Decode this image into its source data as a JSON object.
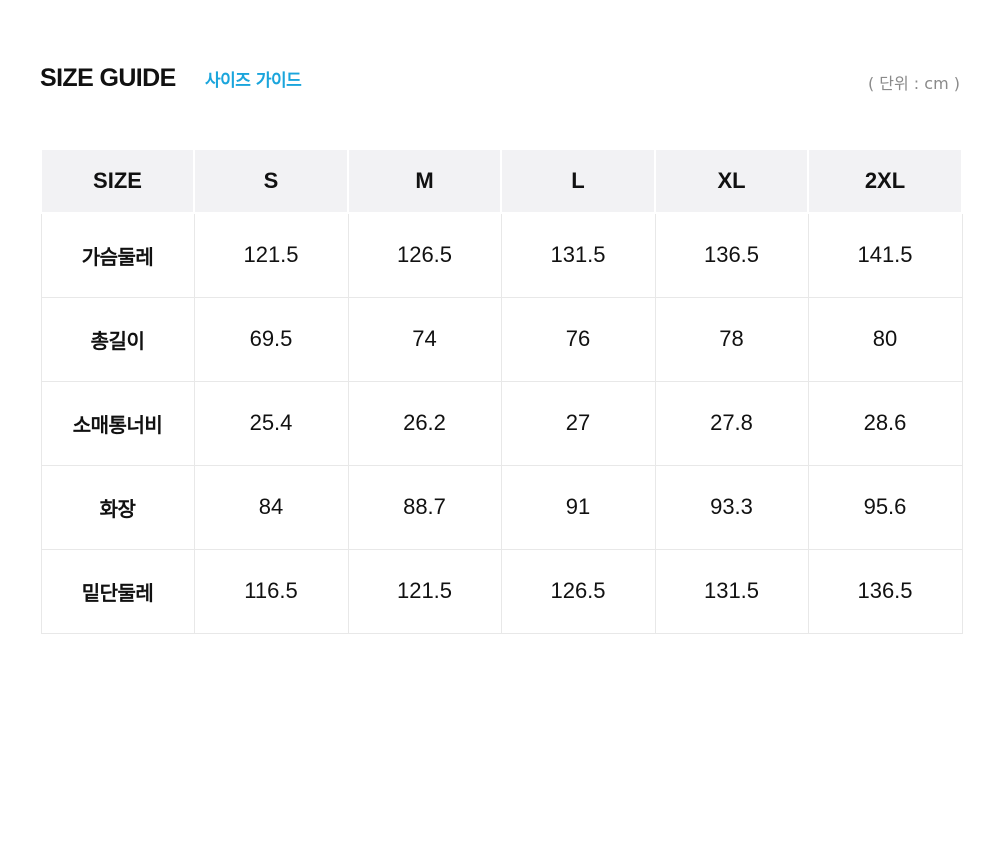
{
  "header": {
    "title": "SIZE GUIDE",
    "subtitle": "사이즈 가이드",
    "unit": "( 단위 : cm )"
  },
  "colors": {
    "accent": "#1aa5dc",
    "header_bg": "#f2f2f4",
    "border": "#e8e8e8",
    "unit_text": "#8a8a8a"
  },
  "table": {
    "columns": [
      "SIZE",
      "S",
      "M",
      "L",
      "XL",
      "2XL"
    ],
    "rows": [
      {
        "label": "가슴둘레",
        "values": [
          "121.5",
          "126.5",
          "131.5",
          "136.5",
          "141.5"
        ]
      },
      {
        "label": "총길이",
        "values": [
          "69.5",
          "74",
          "76",
          "78",
          "80"
        ]
      },
      {
        "label": "소매통너비",
        "values": [
          "25.4",
          "26.2",
          "27",
          "27.8",
          "28.6"
        ]
      },
      {
        "label": "화장",
        "values": [
          "84",
          "88.7",
          "91",
          "93.3",
          "95.6"
        ]
      },
      {
        "label": "밑단둘레",
        "values": [
          "116.5",
          "121.5",
          "126.5",
          "131.5",
          "136.5"
        ]
      }
    ]
  }
}
